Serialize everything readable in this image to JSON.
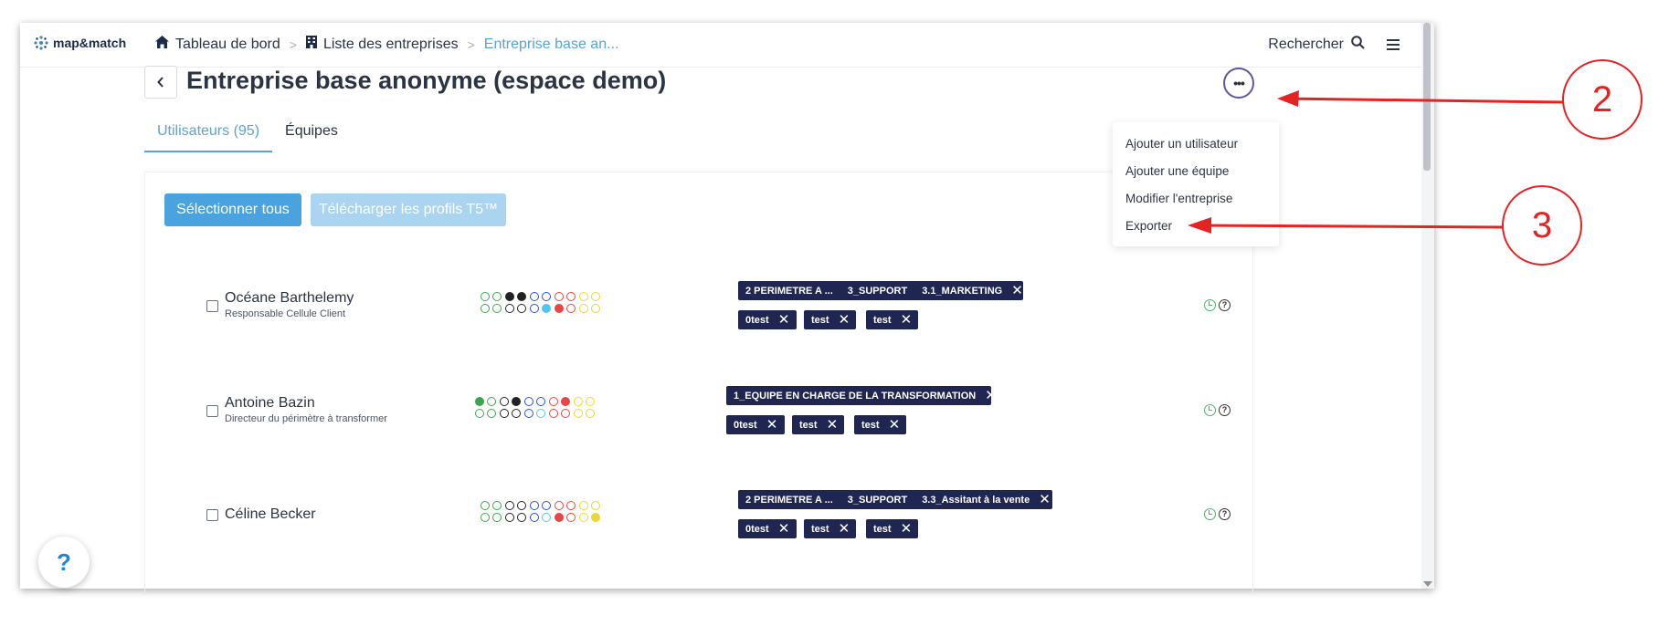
{
  "app": {
    "logo_text": "map&match"
  },
  "breadcrumb": {
    "item1": "Tableau de bord",
    "item2": "Liste des entreprises",
    "item3": "Entreprise base an...",
    "sep": ">"
  },
  "topbar": {
    "search_label": "Rechercher"
  },
  "page": {
    "title": "Entreprise base anonyme (espace demo)"
  },
  "tabs": [
    {
      "label": "Utilisateurs (95)",
      "active": true
    },
    {
      "label": "Équipes",
      "active": false
    }
  ],
  "actions": {
    "select_all": "Sélectionner tous",
    "download": "Télécharger les profils T5™"
  },
  "menu": {
    "items": [
      "Ajouter un utilisateur",
      "Ajouter une équipe",
      "Modifier l'entreprise",
      "Exporter"
    ]
  },
  "users": [
    {
      "name": "Océane Barthelemy",
      "role": "Responsable Cellule Client",
      "path": [
        "2 PERIMETRE A ...",
        "3_SUPPORT",
        "3.1_MARKETING"
      ],
      "tags": [
        "0test",
        "test",
        "test"
      ]
    },
    {
      "name": "Antoine Bazin",
      "role": "Directeur du périmètre à transformer",
      "path": [
        "1_EQUIPE EN CHARGE DE LA TRANSFORMATION"
      ],
      "tags": [
        "0test",
        "test",
        "test"
      ]
    },
    {
      "name": "Céline Becker",
      "role": "",
      "path": [
        "2 PERIMETRE A ...",
        "3_SUPPORT",
        "3.3_Assitant à la vente"
      ],
      "tags": [
        "0test",
        "test",
        "test"
      ]
    }
  ],
  "help_bubble": "?",
  "annotations": [
    "2",
    "3"
  ],
  "colors": {
    "accent": "#4aa3de",
    "tag_bg": "#1f2651",
    "annotation": "#e42323"
  }
}
